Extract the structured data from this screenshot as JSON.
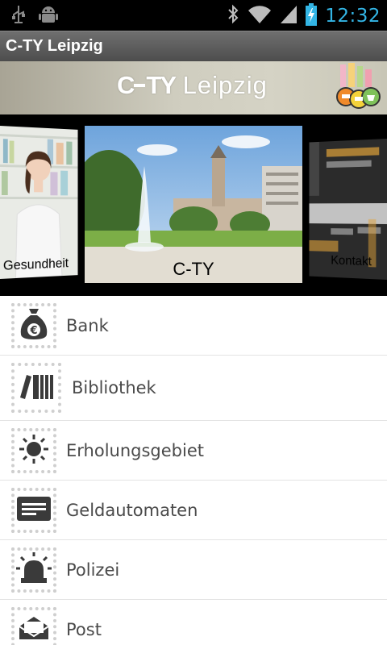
{
  "status_bar": {
    "time": "12:32",
    "icons": [
      "usb-icon",
      "android-debug-icon",
      "bluetooth-icon",
      "wifi-icon",
      "signal-icon",
      "battery-charging-icon"
    ]
  },
  "action_bar": {
    "title": "C-TY Leipzig"
  },
  "banner": {
    "logo_prefix": "C",
    "logo_mid": "TY",
    "logo_city": "Leipzig"
  },
  "carousel": {
    "cards": [
      {
        "caption": "Gesundheit"
      },
      {
        "caption": "C-TY"
      },
      {
        "caption": "Kontakt"
      }
    ]
  },
  "list": {
    "items": [
      {
        "label": "Bank",
        "icon": "money-bag-euro-icon"
      },
      {
        "label": "Bibliothek",
        "icon": "books-icon"
      },
      {
        "label": "Erholungsgebiet",
        "icon": "sun-icon"
      },
      {
        "label": "Geldautomaten",
        "icon": "atm-card-icon"
      },
      {
        "label": "Polizei",
        "icon": "siren-icon"
      },
      {
        "label": "Post",
        "icon": "envelope-icon"
      }
    ]
  },
  "colors": {
    "accent": "#33b5e5",
    "icon": "#3a3a3a",
    "label": "#4a4a4a"
  }
}
